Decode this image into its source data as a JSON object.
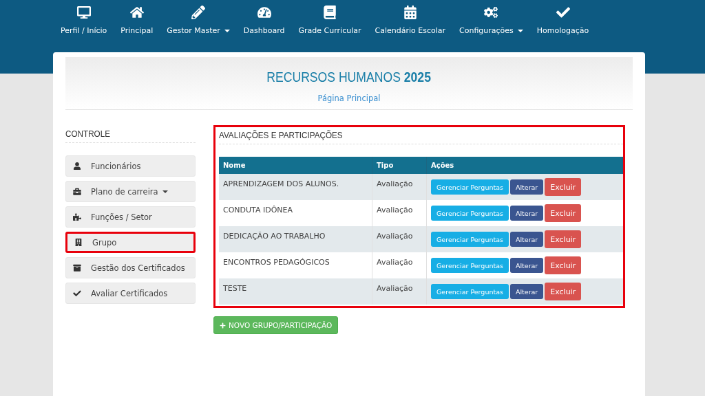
{
  "navbar": {
    "items": [
      {
        "label": "Perfil / Início",
        "dropdown": false
      },
      {
        "label": "Principal",
        "dropdown": false
      },
      {
        "label": "Gestor Master",
        "dropdown": true
      },
      {
        "label": "Dashboard",
        "dropdown": false
      },
      {
        "label": "Grade Curricular",
        "dropdown": false
      },
      {
        "label": "Calendário Escolar",
        "dropdown": false
      },
      {
        "label": "Configurações",
        "dropdown": true
      },
      {
        "label": "Homologação",
        "dropdown": false
      }
    ]
  },
  "header": {
    "title": "RECURSOS HUMANOS **2025**",
    "link": "Página Principal"
  },
  "sidebar": {
    "title": "CONTROLE",
    "items": [
      {
        "label": "Funcionários",
        "dropdown": false,
        "highlighted": false
      },
      {
        "label": "Plano de carreira",
        "dropdown": true,
        "highlighted": false
      },
      {
        "label": "Funções / Setor",
        "dropdown": false,
        "highlighted": false
      },
      {
        "label": "Grupo",
        "dropdown": false,
        "highlighted": true
      },
      {
        "label": "Gestão dos Certificados",
        "dropdown": false,
        "highlighted": false
      },
      {
        "label": "Avaliar Certificados",
        "dropdown": false,
        "highlighted": false
      }
    ]
  },
  "section": {
    "title": "AVALIAÇÕES E PARTICIPAÇÕES",
    "highlighted": true,
    "table": {
      "columns": [
        "Nome",
        "Tipo",
        "Ações"
      ],
      "rows": [
        {
          "name": "APRENDIZAGEM DOS ALUNOS.",
          "type": "Avaliação",
          "actions": [
            "Gerenciar Perguntas",
            "Alterar",
            "Excluir"
          ]
        },
        {
          "name": "CONDUTA IDÔNEA",
          "type": "Avaliação",
          "actions": [
            "Gerenciar Perguntas",
            "Alterar",
            "Excluir"
          ]
        },
        {
          "name": "DEDICAÇÃO AO TRABALHO",
          "type": "Avaliação",
          "actions": [
            "Gerenciar Perguntas",
            "Alterar",
            "Excluir"
          ]
        },
        {
          "name": "ENCONTROS PEDAGÓGICOS",
          "type": "Avaliação",
          "actions": [
            "Gerenciar Perguntas",
            "Alterar",
            "Excluir"
          ]
        },
        {
          "name": "TESTE",
          "type": "Avaliação",
          "actions": [
            "Gerenciar Perguntas",
            "Alterar",
            "Excluir"
          ]
        }
      ]
    },
    "add_button": "NOVO GRUPO/PARTICIPAÇÃO"
  }
}
